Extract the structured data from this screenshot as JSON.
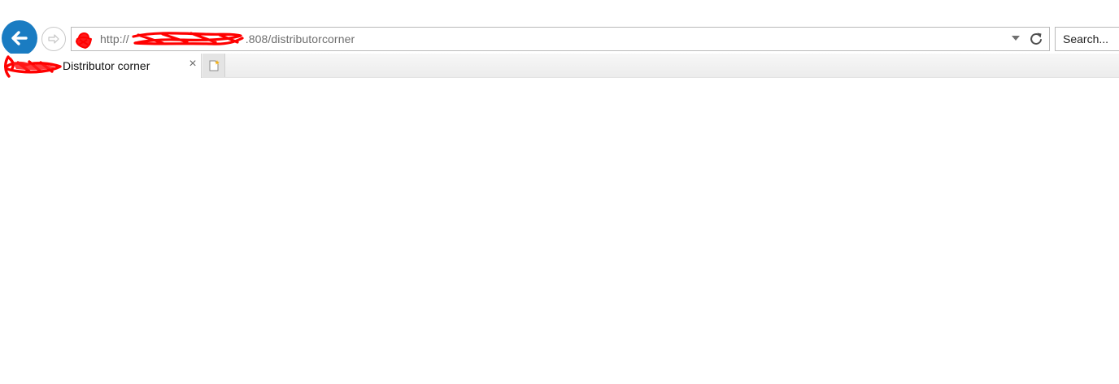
{
  "browser": {
    "address_bar": {
      "url_prefix": "http://",
      "url_port_fragment": ".808",
      "url_path": "/distributorcorner",
      "site_icon": "lock-icon",
      "dropdown_icon": "chevron-down-icon",
      "refresh_icon": "refresh-icon"
    },
    "search": {
      "placeholder": "Search..."
    },
    "nav": {
      "back_icon": "back-arrow-icon",
      "forward_icon": "forward-arrow-icon"
    },
    "tabs": [
      {
        "title": "Distributor corner",
        "favicon": "site-favicon",
        "close_label": "×"
      }
    ],
    "new_tab_icon": "new-tab-icon"
  },
  "colors": {
    "back_button": "#1a7cc2",
    "redaction": "#ff0000"
  }
}
